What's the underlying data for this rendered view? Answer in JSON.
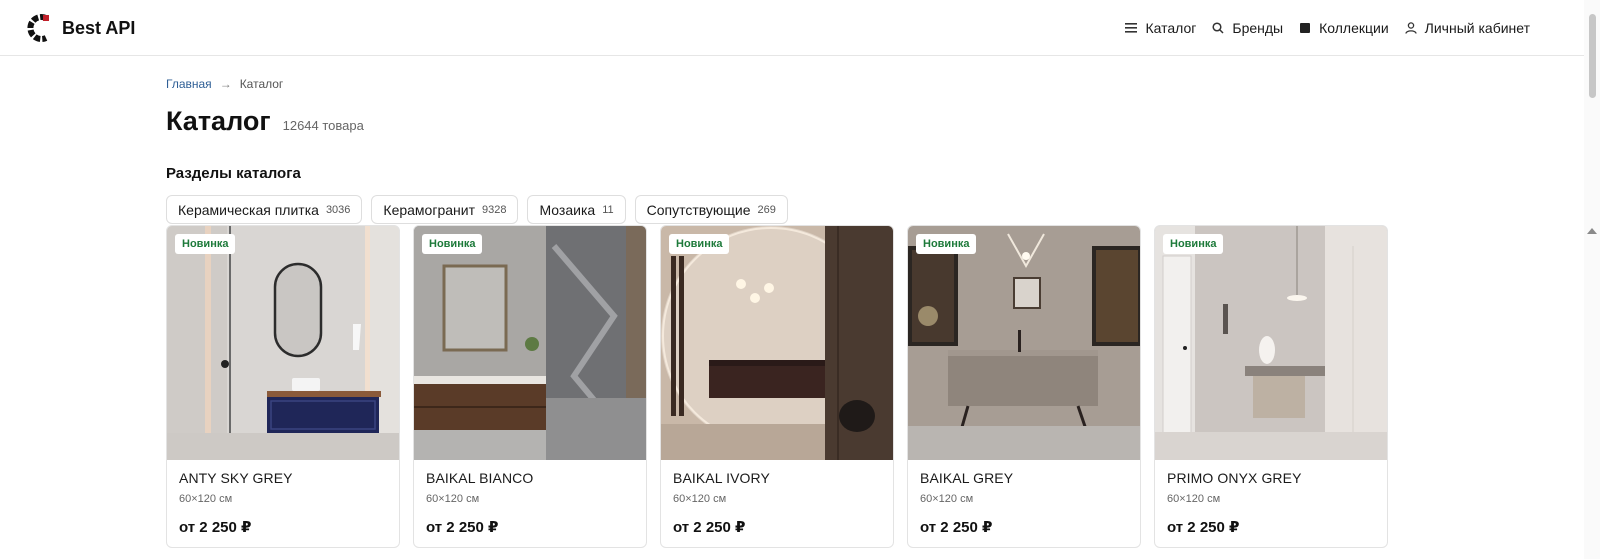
{
  "header": {
    "logo_text": "Best API",
    "nav": [
      {
        "label": "Каталог",
        "icon": "menu-icon"
      },
      {
        "label": "Бренды",
        "icon": "search-icon"
      },
      {
        "label": "Коллекции",
        "icon": "square-icon"
      },
      {
        "label": "Личный кабинет",
        "icon": "user-icon"
      }
    ]
  },
  "breadcrumb": {
    "home": "Главная",
    "separator": "→",
    "current": "Каталог"
  },
  "page": {
    "title": "Каталог",
    "count": "12644 товара",
    "sections_title": "Разделы каталога"
  },
  "sections": [
    {
      "label": "Керамическая плитка",
      "count": "3036"
    },
    {
      "label": "Керамогранит",
      "count": "9328"
    },
    {
      "label": "Мозаика",
      "count": "11"
    },
    {
      "label": "Сопутствующие",
      "count": "269"
    }
  ],
  "products": [
    {
      "badge": "Новинка",
      "name": "ANTY SKY GREY",
      "size": "60×120 см",
      "price": "от 2 250 ₽"
    },
    {
      "badge": "Новинка",
      "name": "BAIKAL BIANCO",
      "size": "60×120 см",
      "price": "от 2 250 ₽"
    },
    {
      "badge": "Новинка",
      "name": "BAIKAL IVORY",
      "size": "60×120 см",
      "price": "от 2 250 ₽"
    },
    {
      "badge": "Новинка",
      "name": "BAIKAL GREY",
      "size": "60×120 см",
      "price": "от 2 250 ₽"
    },
    {
      "badge": "Новинка",
      "name": "PRIMO ONYX GREY",
      "size": "60×120 см",
      "price": "от 2 250 ₽"
    }
  ],
  "colors": {
    "accent_link": "#2f5f96",
    "badge_green": "#1d7a3a"
  }
}
